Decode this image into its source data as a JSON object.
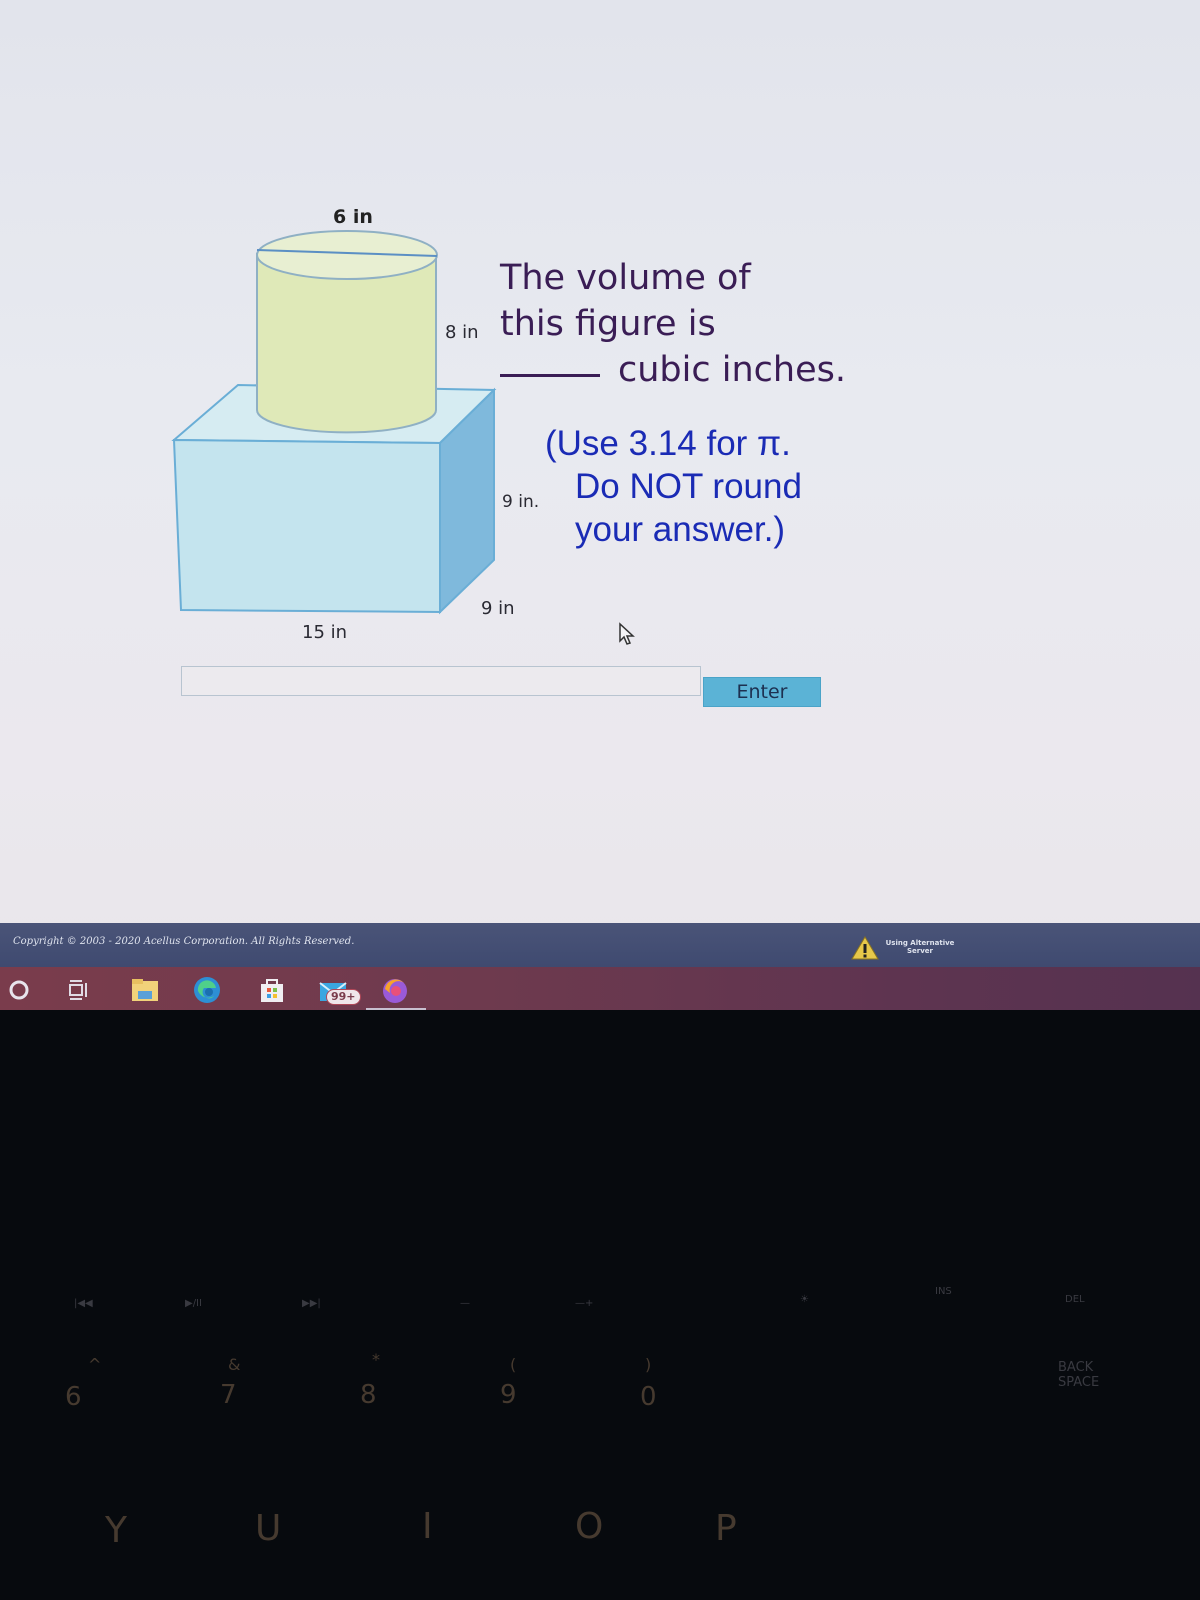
{
  "figure": {
    "cylinder_diameter_label": "6 in",
    "cylinder_height_label": "8 in",
    "prism_height_label": "9 in.",
    "prism_depth_label": "9 in",
    "prism_length_label": "15 in",
    "colors": {
      "cylinder_fill": "#dfe9b8",
      "cylinder_stroke": "#8fb0c4",
      "prism_front": "#c4e4ee",
      "prism_top": "#d6ecf2",
      "prism_side": "#7fb9dc",
      "prism_stroke": "#6aaed6"
    }
  },
  "question": {
    "line1": "The volume of",
    "line2": "this figure is",
    "line3": "cubic inches.",
    "hint_line1": "(Use 3.14 for π.",
    "hint_line2": "Do NOT round",
    "hint_line3": "your answer.)"
  },
  "answer": {
    "value": "",
    "placeholder": "",
    "enter_label": "Enter"
  },
  "footer": {
    "copyright": "Copyright © 2003 - 2020 Acellus Corporation. All Rights Reserved.",
    "server_status_line1": "Using Alternative",
    "server_status_line2": "Server"
  },
  "taskbar": {
    "items": [
      "cortana-search",
      "task-view",
      "file-explorer",
      "edge-browser",
      "microsoft-store",
      "mail",
      "firefox"
    ],
    "mail_badge": "99+"
  },
  "keyboard": {
    "fn_keys": [
      "|◀◀",
      "▶/II",
      "▶▶|",
      "—",
      "—+",
      "☀",
      "INS",
      "DEL"
    ],
    "number_keys": [
      {
        "shift": "^",
        "main": "6"
      },
      {
        "shift": "&",
        "main": "7"
      },
      {
        "shift": "*",
        "main": "8"
      },
      {
        "shift": "(",
        "main": "9"
      },
      {
        "shift": ")",
        "main": "0"
      }
    ],
    "backspace": "BACK SPACE",
    "letter_keys": [
      "Y",
      "U",
      "I",
      "O",
      "P"
    ]
  }
}
